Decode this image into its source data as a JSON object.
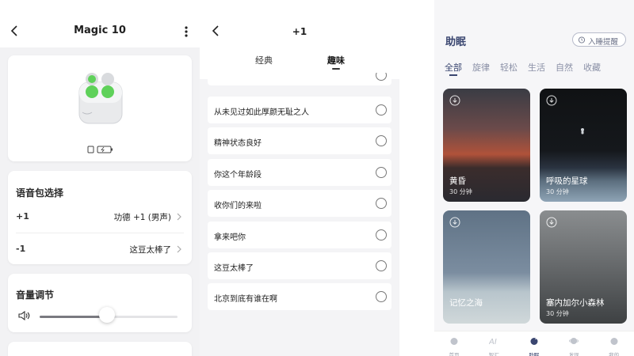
{
  "device": {
    "title": "Magic 10",
    "voice_section_title": "语音包选择",
    "voice_rows": [
      {
        "key": "+1",
        "value": "功德 +1 (男声)"
      },
      {
        "key": "-1",
        "value": "这豆太棒了"
      }
    ],
    "volume_section_title": "音量调节",
    "volume_level": 0.49
  },
  "voice_pack": {
    "title": "+1",
    "tabs": [
      {
        "label": "经典",
        "active": false
      },
      {
        "label": "趣味",
        "active": true
      }
    ],
    "items": [
      "从未见过如此厚颜无耻之人",
      "精神状态良好",
      "你这个年龄段",
      "收你们的来啦",
      "拿来吧你",
      "这豆太棒了",
      "北京到底有谁在啊"
    ]
  },
  "sleep": {
    "title": "助眠",
    "remind_label": "入睡提醒",
    "categories": [
      {
        "label": "全部",
        "active": true
      },
      {
        "label": "旋律",
        "active": false
      },
      {
        "label": "轻松",
        "active": false
      },
      {
        "label": "生活",
        "active": false
      },
      {
        "label": "自然",
        "active": false
      },
      {
        "label": "收藏",
        "active": false
      }
    ],
    "tiles": [
      {
        "name": "黄昏",
        "duration": "30 分钟"
      },
      {
        "name": "呼吸的星球",
        "duration": "30 分钟"
      },
      {
        "name": "记忆之海",
        "duration": ""
      },
      {
        "name": "塞内加尔小森林",
        "duration": "30 分钟"
      }
    ],
    "tabbar": [
      {
        "label": "首页",
        "icon": "home-icon",
        "active": false
      },
      {
        "label": "智汇",
        "icon": "ai-icon",
        "active": false
      },
      {
        "label": "助眠",
        "icon": "sleep-icon",
        "active": true
      },
      {
        "label": "发现",
        "icon": "planet-icon",
        "active": false
      },
      {
        "label": "我的",
        "icon": "profile-icon",
        "active": false
      }
    ]
  },
  "colors": {
    "accent_navy": "#3a4670",
    "device_green": "#5fd15a"
  }
}
